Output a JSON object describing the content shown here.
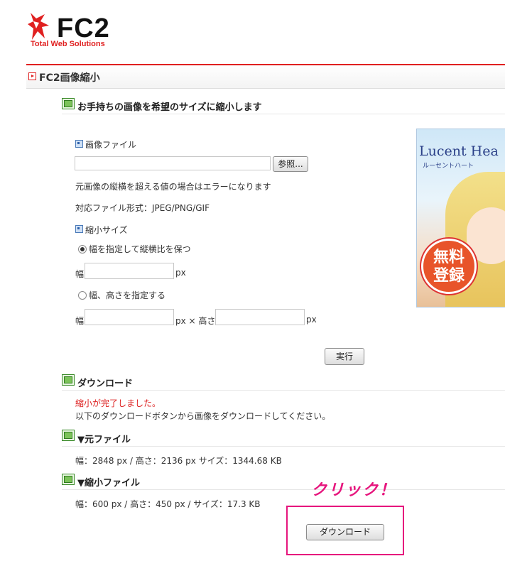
{
  "header": {
    "logo_text": "FC2",
    "logo_subtitle": "Total Web Solutions",
    "page_title": "FC2画像縮小"
  },
  "form": {
    "heading": "お手持ちの画像を希望のサイズに縮小します",
    "file_label": "画像ファイル",
    "file_value": "",
    "browse_label": "参照...",
    "note_error": "元画像の縦横を超える値の場合はエラーになります",
    "note_formats": "対応ファイル形式：JPEG/PNG/GIF",
    "size_label": "縮小サイズ",
    "option_keep_ratio": "幅を指定して縦横比を保つ",
    "option_keep_ratio_selected": true,
    "width_label": "幅",
    "width_value": "",
    "px_unit": "px",
    "option_both": "幅、高さを指定する",
    "option_both_selected": false,
    "width2_label": "幅",
    "width2_value": "",
    "px_x_height": "px × 高さ",
    "height_value": "",
    "px_unit2": "px",
    "submit_label": "実行"
  },
  "ad": {
    "title": "Lucent Hea",
    "subtitle": "ルーセントハート",
    "badge_line1": "無料",
    "badge_line2": "登録"
  },
  "download": {
    "heading": "ダウンロード",
    "success_message": "縮小が完了しました。",
    "instruction": "以下のダウンロードボタンから画像をダウンロードしてください。",
    "original_heading": "▼元ファイル",
    "original_info": "幅：2848 px / 高さ：2136 px サイズ：1344.68 KB",
    "reduced_heading": "▼縮小ファイル",
    "reduced_info": "幅：600 px / 高さ：450 px / サイズ：17.3 KB",
    "download_button": "ダウンロード"
  },
  "annotation": {
    "click_note": "クリック！"
  },
  "colors": {
    "brand_red": "#e02020",
    "annotation_pink": "#e6157d",
    "section_green": "#3a8a2a"
  }
}
